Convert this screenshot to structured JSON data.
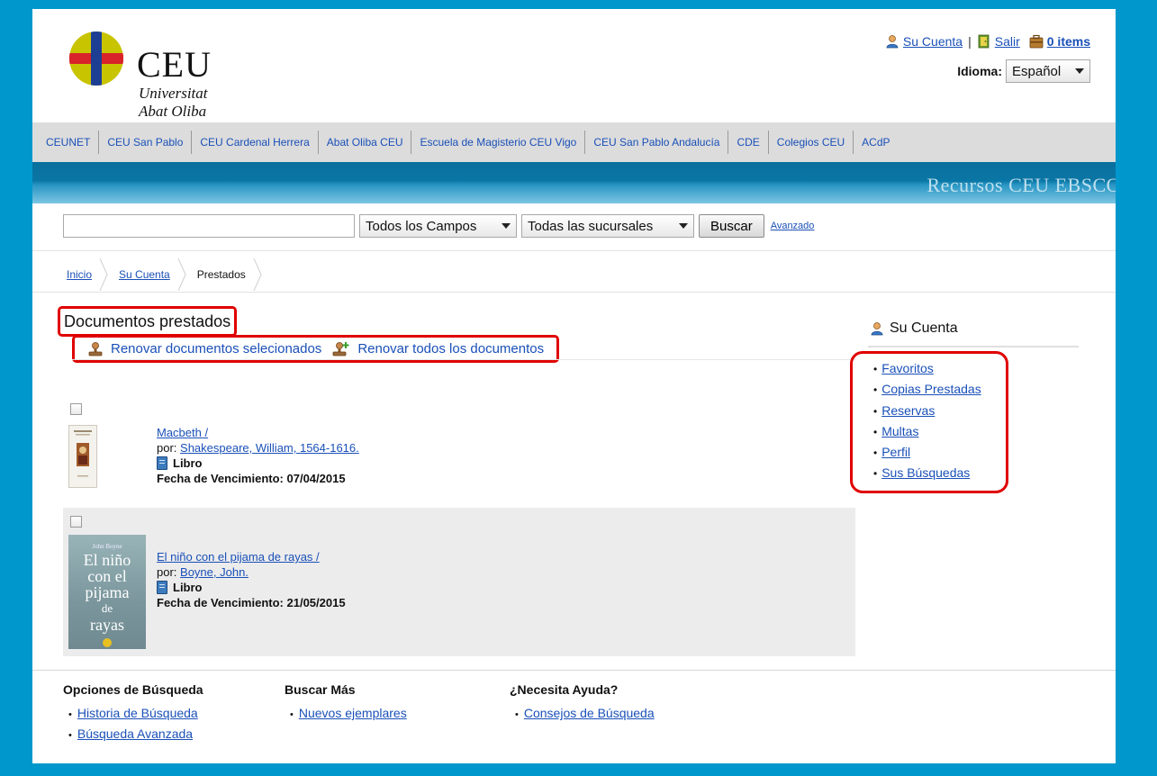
{
  "brand": {
    "name": "CEU",
    "line1": "Universitat",
    "line2": "Abat Oliba",
    "colors": {
      "yellow": "#c8c400",
      "red": "#d8232a",
      "blue": "#1d3f93"
    }
  },
  "toplinks": {
    "account": "Su Cuenta",
    "separator": "|",
    "logout": "Salir",
    "cart": "0 items"
  },
  "language": {
    "label": "Idioma:",
    "value": "Español"
  },
  "nav": [
    "CEUNET",
    "CEU San Pablo",
    "CEU Cardenal Herrera",
    "Abat Oliba CEU",
    "Escuela de Magisterio CEU Vigo",
    "CEU San Pablo Andalucía",
    "CDE",
    "Colegios CEU",
    "ACdP"
  ],
  "banner": {
    "text": "Recursos CEU   EBSCO"
  },
  "search": {
    "query": "",
    "field": "Todos los Campos",
    "branch": "Todas las sucursales",
    "button": "Buscar",
    "advanced": "Avanzado"
  },
  "breadcrumb": [
    "Inicio",
    "Su Cuenta",
    "Prestados"
  ],
  "main": {
    "title": "Documentos prestados",
    "renew_selected": "Renovar documentos selecionados",
    "renew_all": "Renovar todos los documentos",
    "items": [
      {
        "title": "Macbeth /",
        "by_label": "por:",
        "author": "Shakespeare, William, 1564-1616.",
        "format": "Libro",
        "due_label": "Fecha de Vencimiento:",
        "due": "07/04/2015"
      },
      {
        "title": "El niño con el pijama de rayas /",
        "by_label": "por:",
        "author": "Boyne, John.",
        "format": "Libro",
        "due_label": "Fecha de Vencimiento:",
        "due": "21/05/2015",
        "cover": {
          "author": "John Boyne",
          "lines": [
            "El niño",
            "con el",
            "pijama",
            "de",
            "rayas"
          ]
        }
      }
    ]
  },
  "sidebar": {
    "title": "Su Cuenta",
    "links": [
      "Favoritos",
      "Copias Prestadas",
      "Reservas",
      "Multas",
      "Perfil",
      "Sus Búsquedas"
    ]
  },
  "footer": {
    "columns": [
      {
        "title": "Opciones de Búsqueda",
        "links": [
          "Historia de Búsqueda",
          "Búsqueda Avanzada"
        ]
      },
      {
        "title": "Buscar Más",
        "links": [
          "Nuevos ejemplares"
        ]
      },
      {
        "title": "¿Necesita Ayuda?",
        "links": [
          "Consejos de Búsqueda"
        ]
      }
    ]
  }
}
